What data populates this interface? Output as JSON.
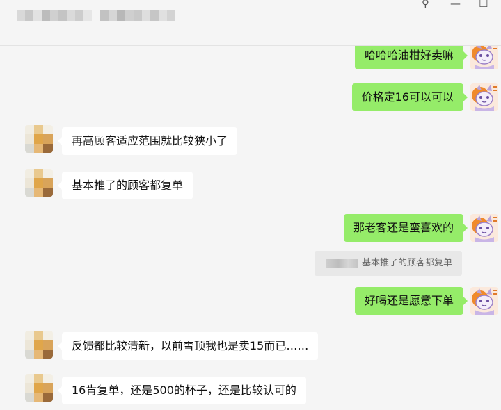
{
  "window": {
    "pin_icon": "pin-icon",
    "minimize_icon": "minimize-icon",
    "maximize_icon": "maximize-icon",
    "pin_glyph": "⚲",
    "minimize_glyph": "—",
    "maximize_glyph": "☐"
  },
  "colors": {
    "sent_bubble": "#95ec69",
    "received_bubble": "#ffffff",
    "background": "#f5f5f5",
    "quote_background": "#e8e8e8"
  },
  "messages": [
    {
      "side": "me",
      "text": "哈哈哈油柑好卖嘛"
    },
    {
      "side": "me",
      "text": "价格定16可以可以"
    },
    {
      "side": "them",
      "text": "再高顾客适应范围就比较狭小了"
    },
    {
      "side": "them",
      "text": "基本推了的顾客都复单"
    },
    {
      "side": "me",
      "text": "那老客还是蛮喜欢的"
    },
    {
      "side": "me",
      "text": "好喝还是愿意下单"
    },
    {
      "side": "them",
      "text": "反馈都比较清新，以前雪顶我也是卖15而已……"
    },
    {
      "side": "them",
      "text": "16肯复单，还是500的杯子，还是比较认可的"
    }
  ],
  "quote": {
    "text": "基本推了的顾客都复单"
  }
}
